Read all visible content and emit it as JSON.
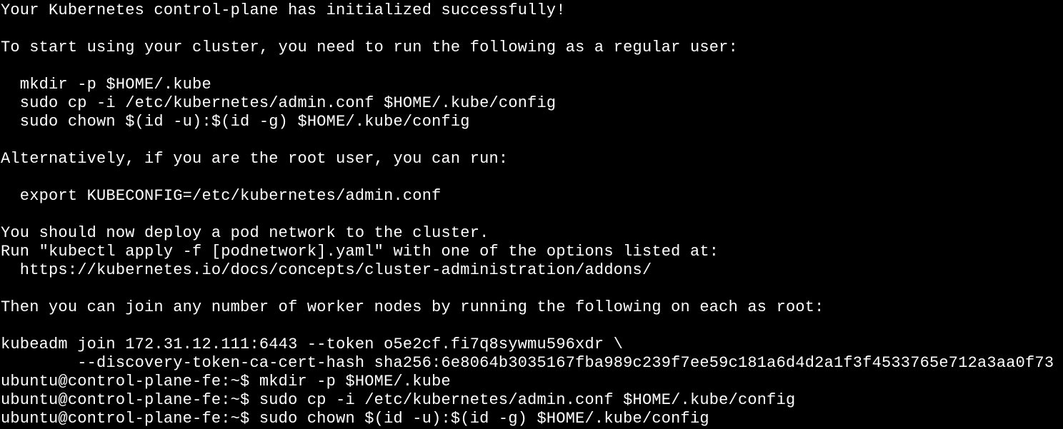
{
  "terminal": {
    "lines": [
      "Your Kubernetes control-plane has initialized successfully!",
      "",
      "To start using your cluster, you need to run the following as a regular user:",
      "",
      "  mkdir -p $HOME/.kube",
      "  sudo cp -i /etc/kubernetes/admin.conf $HOME/.kube/config",
      "  sudo chown $(id -u):$(id -g) $HOME/.kube/config",
      "",
      "Alternatively, if you are the root user, you can run:",
      "",
      "  export KUBECONFIG=/etc/kubernetes/admin.conf",
      "",
      "You should now deploy a pod network to the cluster.",
      "Run \"kubectl apply -f [podnetwork].yaml\" with one of the options listed at:",
      "  https://kubernetes.io/docs/concepts/cluster-administration/addons/",
      "",
      "Then you can join any number of worker nodes by running the following on each as root:",
      "",
      "kubeadm join 172.31.12.111:6443 --token o5e2cf.fi7q8sywmu596xdr \\",
      "        --discovery-token-ca-cert-hash sha256:6e8064b3035167fba989c239f7ee59c181a6d4d2a1f3f4533765e712a3aa0f73",
      "ubuntu@control-plane-fe:~$ mkdir -p $HOME/.kube",
      "ubuntu@control-plane-fe:~$ sudo cp -i /etc/kubernetes/admin.conf $HOME/.kube/config",
      "ubuntu@control-plane-fe:~$ sudo chown $(id -u):$(id -g) $HOME/.kube/config"
    ]
  },
  "colors": {
    "background": "#000000",
    "foreground": "#ffffff"
  }
}
